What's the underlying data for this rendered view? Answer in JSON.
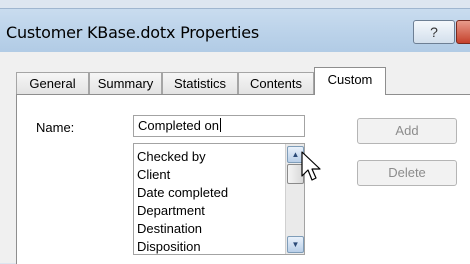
{
  "window": {
    "title": "Customer KBase.dotx Properties",
    "help_label": "?"
  },
  "tabs": [
    {
      "label": "General",
      "active": false
    },
    {
      "label": "Summary",
      "active": false
    },
    {
      "label": "Statistics",
      "active": false
    },
    {
      "label": "Contents",
      "active": false
    },
    {
      "label": "Custom",
      "active": true
    }
  ],
  "custom": {
    "name_label": "Name:",
    "name_value": "Completed on",
    "list_items": [
      "Checked by",
      "Client",
      "Date completed",
      "Department",
      "Destination",
      "Disposition"
    ],
    "add_label": "Add",
    "delete_label": "Delete"
  },
  "icons": {
    "scroll_up": "scroll-up-arrow-icon",
    "scroll_down": "scroll-down-arrow-icon",
    "pointer": "mouse-pointer-icon",
    "help": "help-question-icon",
    "close": "close-icon"
  }
}
